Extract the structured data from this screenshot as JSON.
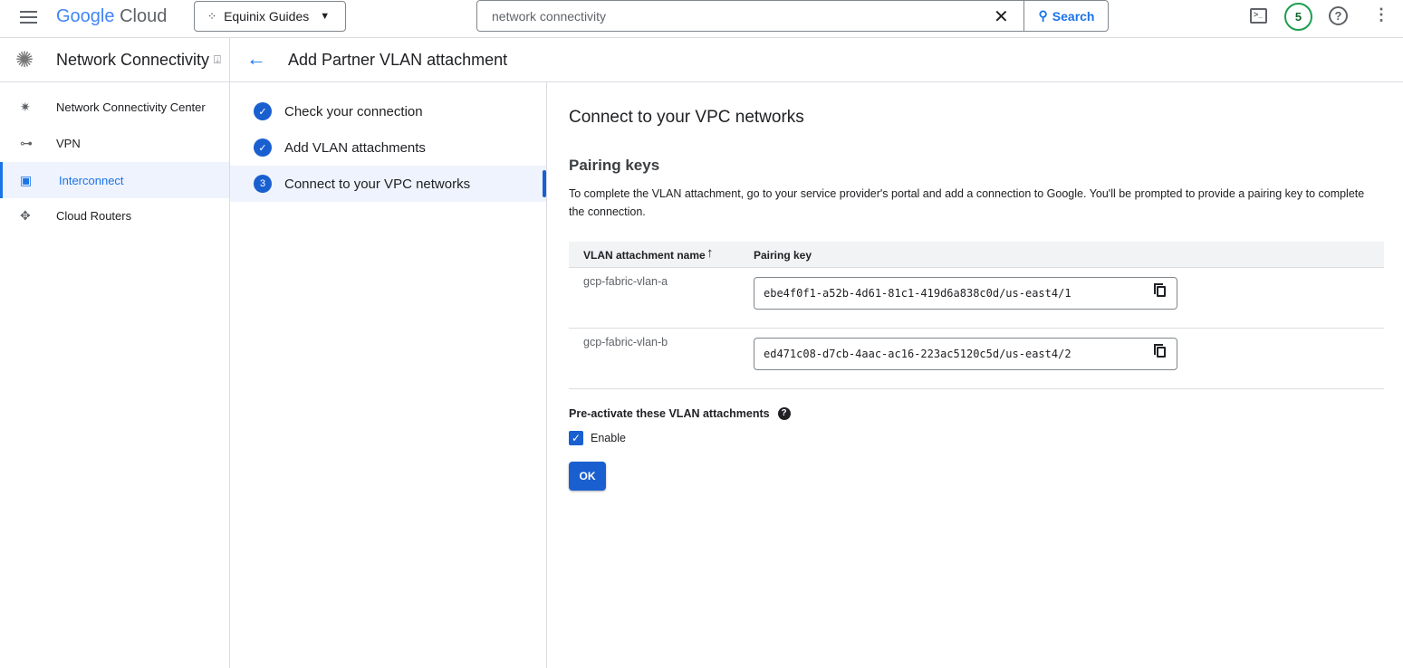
{
  "header": {
    "logo_google": "Google",
    "logo_cloud": "Cloud",
    "project": "Equinix Guides",
    "search_value": "network connectivity",
    "search_button": "Search",
    "avatar_count": "5"
  },
  "product": {
    "title": "Network Connectivity"
  },
  "page": {
    "title": "Add Partner VLAN attachment"
  },
  "sidebar": {
    "items": [
      {
        "label": "Network Connectivity Center",
        "icon": "hub-icon"
      },
      {
        "label": "VPN",
        "icon": "vpn-icon"
      },
      {
        "label": "Interconnect",
        "icon": "interconnect-icon",
        "active": true
      },
      {
        "label": "Cloud Routers",
        "icon": "router-icon"
      }
    ]
  },
  "steps": [
    {
      "label": "Check your connection",
      "status": "done"
    },
    {
      "label": "Add VLAN attachments",
      "status": "done"
    },
    {
      "label": "Connect to your VPC networks",
      "number": "3",
      "status": "active"
    }
  ],
  "main": {
    "heading": "Connect to your VPC networks",
    "section": "Pairing keys",
    "description": "To complete the VLAN attachment, go to your service provider's portal and add a connection to Google. You'll be prompted to provide a pairing key to complete the connection.",
    "table": {
      "headers": [
        "VLAN attachment name",
        "Pairing key"
      ],
      "rows": [
        {
          "name": "gcp-fabric-vlan-a",
          "key": "ebe4f0f1-a52b-4d61-81c1-419d6a838c0d/us-east4/1"
        },
        {
          "name": "gcp-fabric-vlan-b",
          "key": "ed471c08-d7cb-4aac-ac16-223ac5120c5d/us-east4/2"
        }
      ]
    },
    "preactivate_label": "Pre-activate these VLAN attachments",
    "enable_label": "Enable",
    "enable_checked": true,
    "ok_button": "OK"
  },
  "colors": {
    "accent": "#1a73e8",
    "button": "#1a5fd0",
    "avatar": "#188038"
  }
}
